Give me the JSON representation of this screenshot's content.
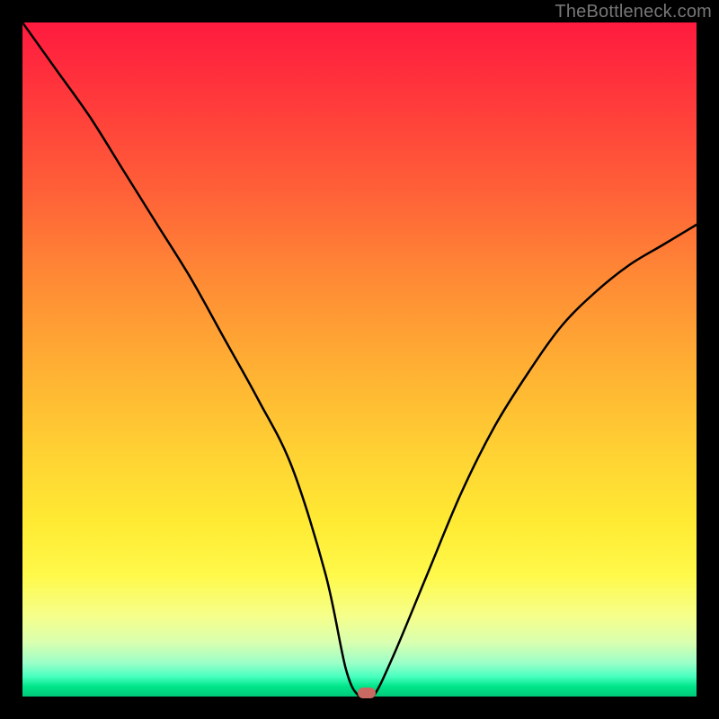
{
  "watermark": "TheBottleneck.com",
  "chart_data": {
    "type": "line",
    "title": "",
    "xlabel": "",
    "ylabel": "",
    "xlim": [
      0,
      100
    ],
    "ylim": [
      0,
      100
    ],
    "x": [
      0,
      5,
      10,
      15,
      20,
      25,
      30,
      35,
      40,
      45,
      48,
      50,
      52,
      55,
      60,
      65,
      70,
      75,
      80,
      85,
      90,
      95,
      100
    ],
    "values": [
      100,
      93,
      86,
      78,
      70,
      62,
      53,
      44,
      34,
      18,
      4,
      0,
      0,
      6,
      18,
      30,
      40,
      48,
      55,
      60,
      64,
      67,
      70
    ],
    "marker": {
      "x": 51,
      "y": 0
    },
    "gradient_stops": [
      {
        "pos": 0.0,
        "color": "#ff1a3f"
      },
      {
        "pos": 0.25,
        "color": "#ff6038"
      },
      {
        "pos": 0.52,
        "color": "#ffb233"
      },
      {
        "pos": 0.74,
        "color": "#ffea33"
      },
      {
        "pos": 0.92,
        "color": "#d9ffb0"
      },
      {
        "pos": 1.0,
        "color": "#00c878"
      }
    ]
  }
}
